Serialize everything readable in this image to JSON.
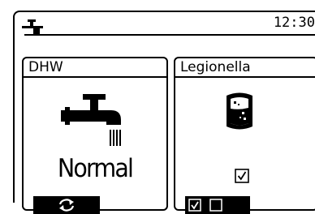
{
  "header": {
    "time": "12:30",
    "icon": "tap-icon"
  },
  "panels": {
    "dhw": {
      "title": "DHW",
      "mode": "Normal",
      "icon": "faucet-icon",
      "button_icon": "refresh-icon"
    },
    "legionella": {
      "title": "Legionella",
      "icon": "water-tank-icon",
      "enabled": true,
      "footer": {
        "option_checked": true,
        "option_unchecked": false
      }
    }
  },
  "colors": {
    "foreground": "#000000",
    "background": "#ffffff"
  }
}
